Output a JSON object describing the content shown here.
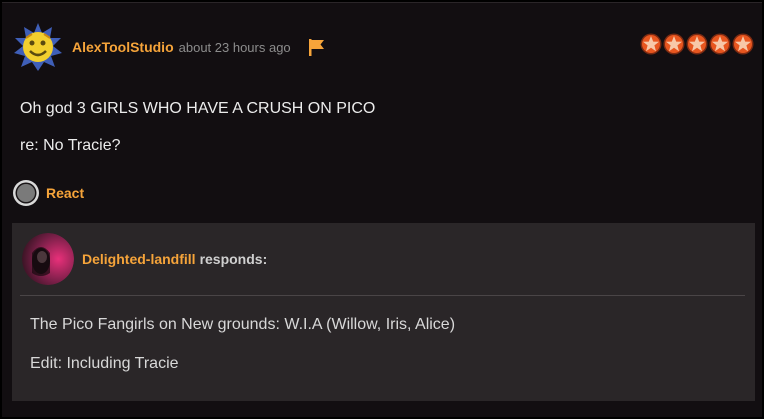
{
  "post": {
    "author": "AlexToolStudio",
    "time": "about 23 hours ago",
    "rating": 5,
    "lines": [
      "Oh god 3 GIRLS WHO HAVE A CRUSH ON PICO",
      "re: No Tracie?"
    ],
    "react_label": "React"
  },
  "response": {
    "author": "Delighted-landfill",
    "suffix": "responds:",
    "lines": [
      "The Pico Fangirls on New grounds: W.I.A (Willow, Iris, Alice)",
      "Edit: Including Tracie"
    ]
  },
  "colors": {
    "accent": "#f6a43a",
    "background": "#120e11",
    "response_background": "#2a2628"
  },
  "icons": {
    "avatar": "sun-face-avatar",
    "flag": "flag-icon",
    "star": "star-icon",
    "react": "react-circle-icon",
    "response_avatar": "user-avatar"
  }
}
